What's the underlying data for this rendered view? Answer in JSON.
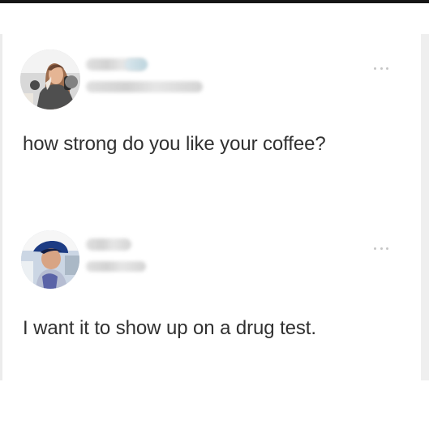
{
  "posts": [
    {
      "avatar_icon": "profile-photo-woman-icon",
      "username_blurred": true,
      "more_icon": "more-options-icon",
      "text": "how strong do you like your coffee?"
    },
    {
      "avatar_icon": "profile-photo-man-icon",
      "username_blurred": true,
      "more_icon": "more-options-icon",
      "text": "I want it to show up on a drug test."
    }
  ],
  "colors": {
    "background": "#ffffff",
    "text": "#303030",
    "top_rule": "#161616",
    "muted_dots": "#c6c6c6"
  }
}
